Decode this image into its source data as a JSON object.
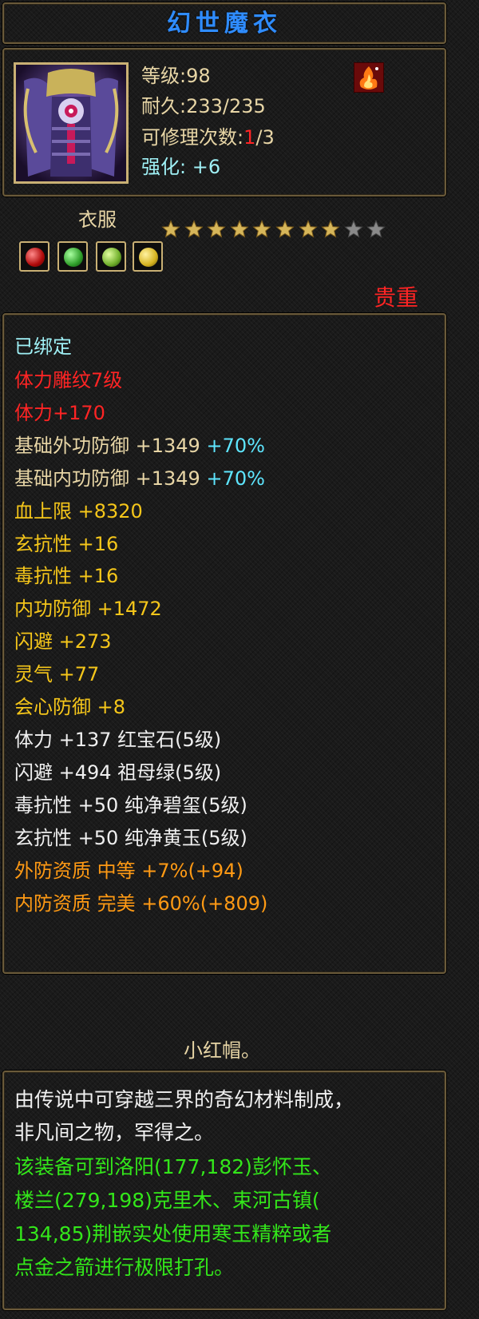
{
  "item": {
    "name": "幻世魔衣",
    "level": "等级:98",
    "durability": "耐久:233/235",
    "repair_prefix": "可修理次数:",
    "repair_used": "1",
    "repair_total": "/3",
    "enhance_label": "强化:",
    "enhance_value": "+6",
    "type": "衣服",
    "stars_total": 9,
    "stars_filled": 8,
    "rarity": "贵重"
  },
  "gems": [
    {
      "icon": "ruby-gem-icon",
      "color": "#d01818"
    },
    {
      "icon": "emerald-gem-icon",
      "color": "#2f9e2a"
    },
    {
      "icon": "jade-gem-icon",
      "color": "#6fae2a"
    },
    {
      "icon": "topaz-gem-icon",
      "color": "#d6b320"
    }
  ],
  "stats": {
    "bound": "已绑定",
    "carving": "体力雕纹7级",
    "carving_stat": "体力+170",
    "base_ext_def": "基础外功防御 +1349",
    "base_ext_def_pct": "+70%",
    "base_int_def": "基础内功防御 +1349",
    "base_int_def_pct": "+70%",
    "hp": "血上限 +8320",
    "xuan_res": "玄抗性 +16",
    "poison_res": "毒抗性 +16",
    "int_def": "内功防御 +1472",
    "dodge": "闪避 +273",
    "spirit": "灵气 +77",
    "crit_def": "会心防御 +8",
    "gem_line1": "体力 +137 红宝石(5级)",
    "gem_line2": "闪避 +494 祖母绿(5级)",
    "gem_line3": "毒抗性 +50 纯净碧玺(5级)",
    "gem_line4": "玄抗性 +50 纯净黄玉(5级)",
    "ext_quality": "外防资质  中等 +7%(+94)",
    "int_quality": "内防资质  完美 +60%(+809)"
  },
  "owner": "小红帽。",
  "description": {
    "line1": "由传说中可穿越三界的奇幻材料制成，",
    "line2": "非凡间之物，罕得之。",
    "line3": "该装备可到洛阳(177,182)彭怀玉、",
    "line4": "楼兰(279,198)克里木、束河古镇(",
    "line5": "134,85)荆嵌实处使用寒玉精粹或者",
    "line6": "点金之箭进行极限打孔。"
  },
  "colors": {
    "title": "#2f8cff",
    "accent_cyan": "#9ff0f5",
    "stat_gold": "#f5c61a",
    "quality_orange": "#ff9a14",
    "desc_green": "#33e61a",
    "rarity_red": "#ff2424"
  }
}
